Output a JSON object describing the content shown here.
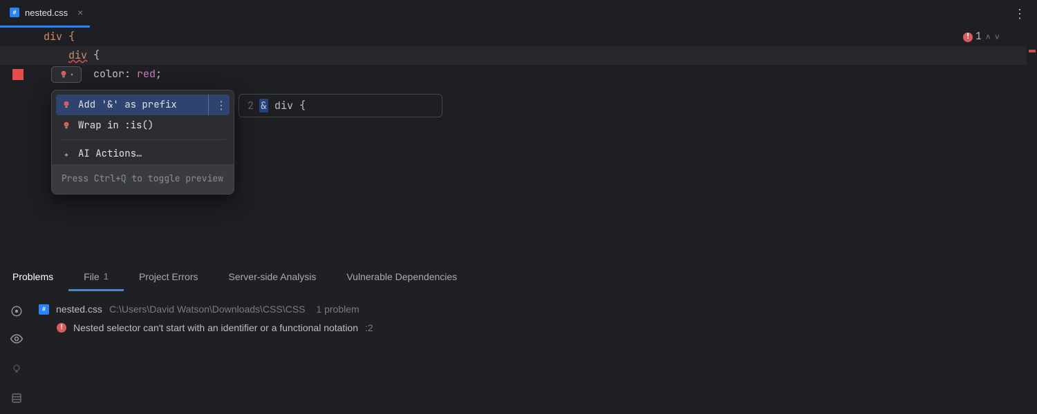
{
  "tab": {
    "filename": "nested.css"
  },
  "editor": {
    "lines": {
      "l1": "div {",
      "l2_indent": "    ",
      "l2_err": "div",
      "l2_rest": " {",
      "l3_indent": "        ",
      "l3_prop": "color",
      "l3_colon": ": ",
      "l3_val": "red",
      "l3_semi": ";"
    },
    "errors_count": "1"
  },
  "intention": {
    "action1": "Add '&' as prefix",
    "action2": "Wrap in :is()",
    "ai_actions": "AI Actions…",
    "hint": "Press Ctrl+Q to toggle preview"
  },
  "preview": {
    "line_no": "2",
    "amp": "&",
    "sel": " div ",
    "brace": "{"
  },
  "problems_panel": {
    "tabs": {
      "problems": "Problems",
      "file": "File",
      "file_count": "1",
      "project_errors": "Project Errors",
      "server": "Server-side Analysis",
      "vulnerable": "Vulnerable Dependencies"
    },
    "file": {
      "name": "nested.css",
      "path": "C:\\Users\\David Watson\\Downloads\\CSS\\CSS",
      "count": "1 problem"
    },
    "problem": {
      "msg": "Nested selector can't start with an identifier or a functional notation",
      "loc": ":2"
    }
  }
}
